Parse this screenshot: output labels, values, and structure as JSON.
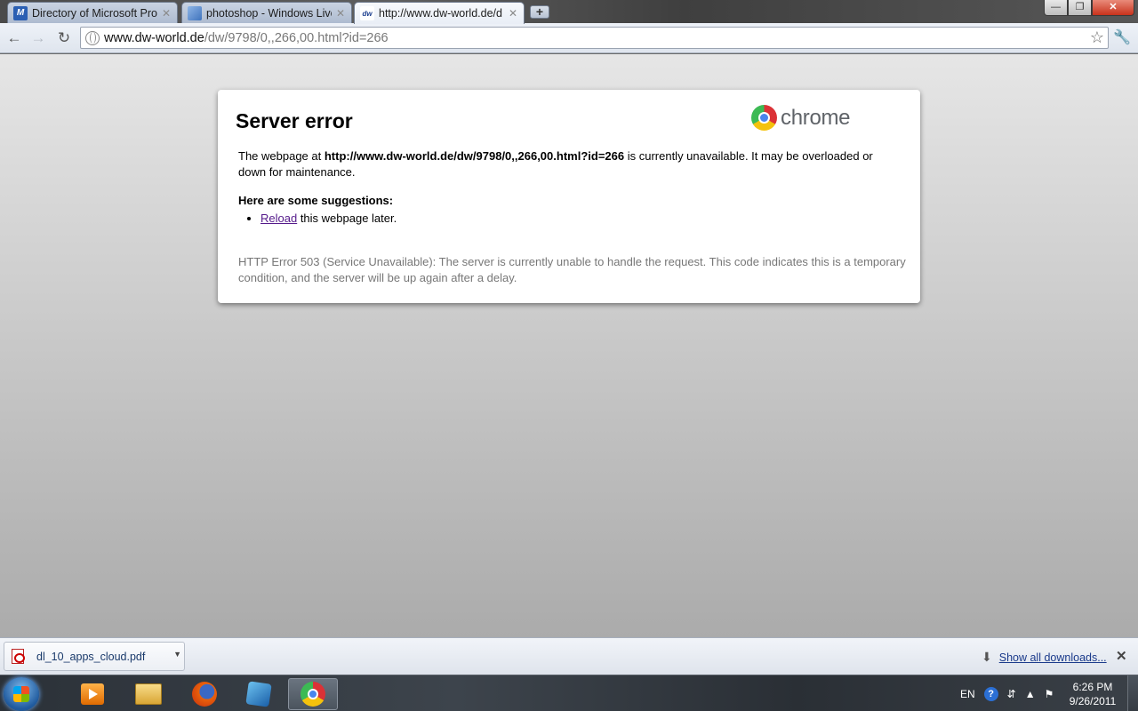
{
  "tabs": [
    {
      "title": "Directory of Microsoft Prod",
      "favicon": "M",
      "favicon_color": "#2b5fb3"
    },
    {
      "title": "photoshop - Windows Live",
      "favicon": "",
      "favicon_color": "#5a87c6"
    },
    {
      "title": "http://www.dw-world.de/d",
      "favicon": "dw",
      "favicon_color": "#1c3f8f"
    }
  ],
  "omnibox": {
    "host": "www.dw-world.de",
    "path": "/dw/9798/0,,266,00.html?id=266"
  },
  "error_page": {
    "title": "Server error",
    "logo_text": "chrome",
    "msg_prefix": "The webpage at ",
    "msg_url": "http://www.dw-world.de/dw/9798/0,,266,00.html?id=266",
    "msg_suffix": " is currently unavailable. It may be overloaded or down for maintenance.",
    "suggestions_heading": "Here are some suggestions:",
    "reload_link": "Reload",
    "reload_suffix": " this webpage later.",
    "detail": "HTTP Error 503 (Service Unavailable): The server is currently unable to handle the request. This code indicates this is a temporary condition, and the server will be up again after a delay."
  },
  "downloads": {
    "item_name": "dl_10_apps_cloud.pdf",
    "show_all": "Show all downloads..."
  },
  "taskbar": {
    "language": "EN",
    "time": "6:26 PM",
    "date": "9/26/2011"
  }
}
